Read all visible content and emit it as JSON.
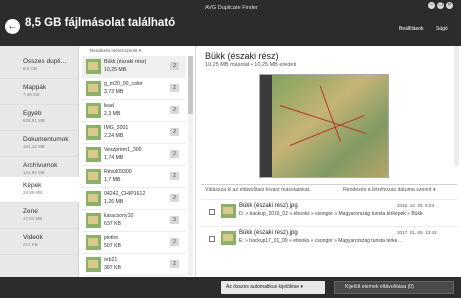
{
  "window": {
    "app_name": "AVG Duplicate Finder",
    "headline": "8,5 GB fájlmásolat található",
    "settings_link": "Beállítások",
    "help_link": "Súgó",
    "window_buttons": [
      "–",
      "❐",
      "✕"
    ]
  },
  "sidebar": {
    "categories": [
      {
        "name": "Összes dupli…",
        "size": "8,5 GB"
      },
      {
        "name": "Mappák",
        "size": "7,36 GB"
      },
      {
        "name": "Egyéb",
        "size": "828,81 MB"
      },
      {
        "name": "Dokumentumok",
        "size": "161,12 MB"
      },
      {
        "name": "Archívumok",
        "size": "141,93 MB"
      },
      {
        "name": "Képek",
        "size": "28,89 MB"
      },
      {
        "name": "Zene",
        "size": "17,61 MB"
      },
      {
        "name": "Videók",
        "size": "210 KB"
      }
    ],
    "active_index": 5
  },
  "filelist": {
    "sort_label": "Rendezés méret szerint ▾",
    "files": [
      {
        "name": "Bükk (északi rész)",
        "size": "10,25 MB",
        "count": "2"
      },
      {
        "name": "g_m20_00_color",
        "size": "3,73 MB",
        "count": "2"
      },
      {
        "name": "lead",
        "size": "2,3 MB",
        "count": "2"
      },
      {
        "name": "IMG_3001",
        "size": "2,24 MB",
        "count": "2"
      },
      {
        "name": "Veszprém1_300",
        "size": "1,74 MB",
        "count": "2"
      },
      {
        "name": "Révül09300",
        "size": "1,7 MB",
        "count": "2"
      },
      {
        "name": "04242_CHIP1612",
        "size": "1,26 MB",
        "count": "2"
      },
      {
        "name": "karacsony10",
        "size": "637 KB",
        "count": "3"
      },
      {
        "name": "piotiro",
        "size": "507 KB",
        "count": "2"
      },
      {
        "name": "orb21",
        "size": "387 KB",
        "count": "2"
      }
    ],
    "active_index": 0
  },
  "detail": {
    "title": "Bükk (északi rész)",
    "subtitle": "10,25 MB másolat • 10,25 MB eredeti",
    "instruction": "Válassza ki az eltávolítani kívánt másolatokat.",
    "sort_label": "Rendezés a létrehozás dátuma szerint ▾",
    "copies": [
      {
        "name": "Bükk (északi rész).jpg",
        "path": "D: » backup_2016_02 » ebooks » csongor » Magyarország turista térképek » Bükk",
        "date": "2016. 12. 26. 6:23"
      },
      {
        "name": "Bükk (északi rész).jpg",
        "path": "E: » backup17_01_09 » ebooks » csongor » Magyarország turista térke…",
        "date": "2017. 01. 09. 13:43"
      }
    ]
  },
  "bottom": {
    "auto_select_label": "Az összes automatikus kijelölése ▾",
    "remove_label": "Kijelölt elemek eltávolítása (0)"
  }
}
